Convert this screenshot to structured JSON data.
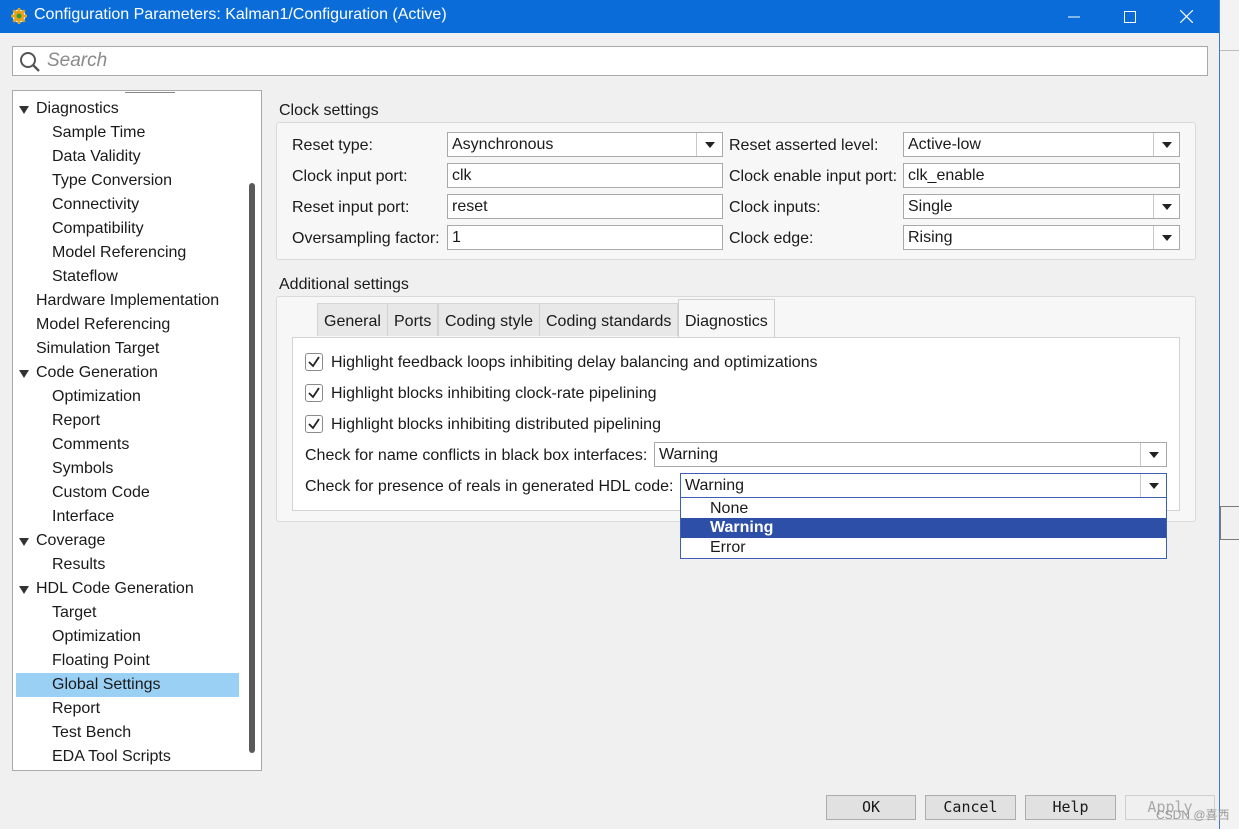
{
  "window": {
    "title": "Configuration Parameters: Kalman1/Configuration (Active)"
  },
  "search": {
    "placeholder": "Search"
  },
  "tree": {
    "items": [
      {
        "label": "Diagnostics",
        "level": 0,
        "expanded": true
      },
      {
        "label": "Sample Time",
        "level": 1
      },
      {
        "label": "Data Validity",
        "level": 1
      },
      {
        "label": "Type Conversion",
        "level": 1
      },
      {
        "label": "Connectivity",
        "level": 1
      },
      {
        "label": "Compatibility",
        "level": 1
      },
      {
        "label": "Model Referencing",
        "level": 1
      },
      {
        "label": "Stateflow",
        "level": 1
      },
      {
        "label": "Hardware Implementation",
        "level": 0
      },
      {
        "label": "Model Referencing",
        "level": 0
      },
      {
        "label": "Simulation Target",
        "level": 0
      },
      {
        "label": "Code Generation",
        "level": 0,
        "expanded": true
      },
      {
        "label": "Optimization",
        "level": 1
      },
      {
        "label": "Report",
        "level": 1
      },
      {
        "label": "Comments",
        "level": 1
      },
      {
        "label": "Symbols",
        "level": 1
      },
      {
        "label": "Custom Code",
        "level": 1
      },
      {
        "label": "Interface",
        "level": 1
      },
      {
        "label": "Coverage",
        "level": 0,
        "expanded": true
      },
      {
        "label": "Results",
        "level": 1
      },
      {
        "label": "HDL Code Generation",
        "level": 0,
        "expanded": true
      },
      {
        "label": "Target",
        "level": 1
      },
      {
        "label": "Optimization",
        "level": 1
      },
      {
        "label": "Floating Point",
        "level": 1
      },
      {
        "label": "Global Settings",
        "level": 1,
        "selected": true
      },
      {
        "label": "Report",
        "level": 1
      },
      {
        "label": "Test Bench",
        "level": 1
      },
      {
        "label": "EDA Tool Scripts",
        "level": 1
      }
    ]
  },
  "clock_settings": {
    "title": "Clock settings",
    "reset_type": {
      "label": "Reset type:",
      "value": "Asynchronous"
    },
    "clock_input_port": {
      "label": "Clock input port:",
      "value": "clk"
    },
    "reset_input_port": {
      "label": "Reset input port:",
      "value": "reset"
    },
    "oversampling_factor": {
      "label": "Oversampling factor:",
      "value": "1"
    },
    "reset_asserted_level": {
      "label": "Reset asserted level:",
      "value": "Active-low"
    },
    "clock_enable_input_port": {
      "label": "Clock enable input port:",
      "value": "clk_enable"
    },
    "clock_inputs": {
      "label": "Clock inputs:",
      "value": "Single"
    },
    "clock_edge": {
      "label": "Clock edge:",
      "value": "Rising"
    }
  },
  "additional_settings": {
    "title": "Additional settings",
    "tabs": [
      "General",
      "Ports",
      "Coding style",
      "Coding standards",
      "Diagnostics"
    ],
    "active_tab": "Diagnostics",
    "checkboxes": [
      {
        "label": "Highlight feedback loops inhibiting delay balancing and optimizations",
        "checked": true
      },
      {
        "label": "Highlight blocks inhibiting clock-rate pipelining",
        "checked": true
      },
      {
        "label": "Highlight blocks inhibiting distributed pipelining",
        "checked": true
      }
    ],
    "name_conflicts": {
      "label": "Check for name conflicts in black box interfaces:",
      "value": "Warning"
    },
    "reals_check": {
      "label": "Check for presence of reals in generated HDL code:",
      "value": "Warning"
    },
    "dropdown_options": [
      "None",
      "Warning",
      "Error"
    ],
    "dropdown_selected": "Warning"
  },
  "buttons": {
    "ok": "OK",
    "cancel": "Cancel",
    "help": "Help",
    "apply": "Apply"
  },
  "watermark": "CSDN @喜西",
  "colors": {
    "titlebar": "#0a6cd8",
    "selection": "#9bd0f5",
    "dropdown_selected": "#2e4fa8"
  }
}
